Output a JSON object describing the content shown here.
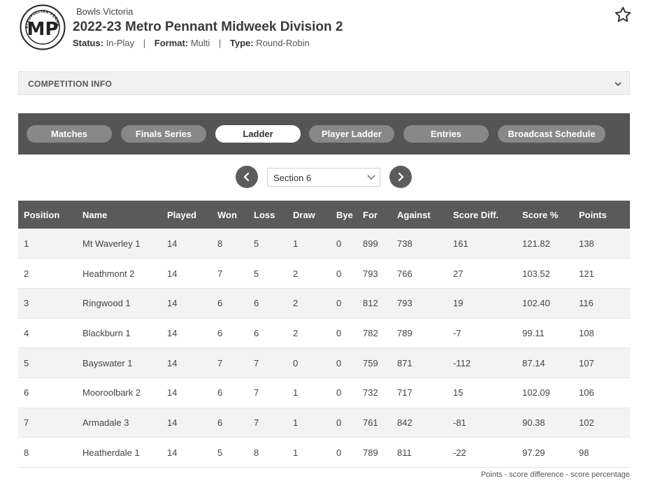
{
  "header": {
    "logo_text": "METROPOLITAN PENNANT",
    "logo_initials": "MP",
    "org": "Bowls Victoria",
    "title": "2022-23 Metro Pennant Midweek Division 2",
    "status_label": "Status:",
    "status_value": "In-Play",
    "format_label": "Format:",
    "format_value": "Multi",
    "type_label": "Type:",
    "type_value": "Round-Robin",
    "favourite_icon": "star-outline-icon"
  },
  "competition_info": {
    "label": "COMPETITION INFO",
    "icon": "chevron-down-icon"
  },
  "tabs": [
    {
      "label": "Matches"
    },
    {
      "label": "Finals Series"
    },
    {
      "label": "Ladder"
    },
    {
      "label": "Player Ladder"
    },
    {
      "label": "Entries"
    },
    {
      "label": "Broadcast Schedule"
    }
  ],
  "active_tab": "Ladder",
  "section_selector": {
    "selected": "Section 6",
    "prev_icon": "chevron-left-icon",
    "next_icon": "chevron-right-icon"
  },
  "ladder": {
    "columns": [
      "Position",
      "Name",
      "Played",
      "Won",
      "Loss",
      "Draw",
      "Bye",
      "For",
      "Against",
      "Score Diff.",
      "Score %",
      "Points"
    ],
    "rows": [
      [
        "1",
        "Mt Waverley 1",
        "14",
        "8",
        "5",
        "1",
        "0",
        "899",
        "738",
        "161",
        "121.82",
        "138"
      ],
      [
        "2",
        "Heathmont 2",
        "14",
        "7",
        "5",
        "2",
        "0",
        "793",
        "766",
        "27",
        "103.52",
        "121"
      ],
      [
        "3",
        "Ringwood 1",
        "14",
        "6",
        "6",
        "2",
        "0",
        "812",
        "793",
        "19",
        "102.40",
        "116"
      ],
      [
        "4",
        "Blackburn 1",
        "14",
        "6",
        "6",
        "2",
        "0",
        "782",
        "789",
        "-7",
        "99.11",
        "108"
      ],
      [
        "5",
        "Bayswater 1",
        "14",
        "7",
        "7",
        "0",
        "0",
        "759",
        "871",
        "-112",
        "87.14",
        "107"
      ],
      [
        "6",
        "Mooroolbark 2",
        "14",
        "6",
        "7",
        "1",
        "0",
        "732",
        "717",
        "15",
        "102.09",
        "106"
      ],
      [
        "7",
        "Armadale 3",
        "14",
        "6",
        "7",
        "1",
        "0",
        "761",
        "842",
        "-81",
        "90.38",
        "102"
      ],
      [
        "8",
        "Heatherdale 1",
        "14",
        "5",
        "8",
        "1",
        "0",
        "789",
        "811",
        "-22",
        "97.29",
        "98"
      ]
    ]
  },
  "footnote": "Points - score difference - score percentage",
  "colors": {
    "tab_bar": "#555555",
    "tab_pill": "#888888",
    "table_header": "#5a5a5a",
    "row_alt": "#f3f3f3"
  }
}
